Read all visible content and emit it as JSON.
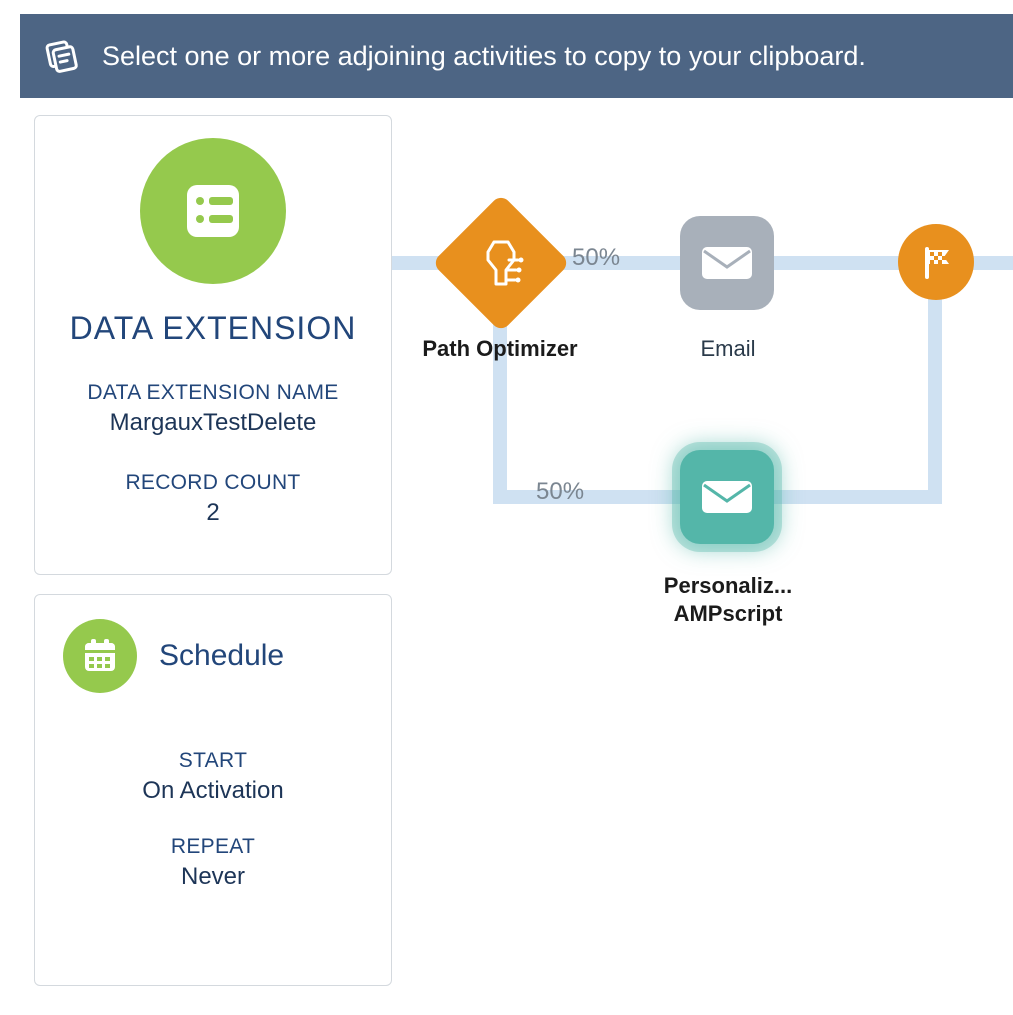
{
  "banner": {
    "text": "Select one or more adjoining activities to copy to your clipboard."
  },
  "entry": {
    "title": "DATA EXTENSION",
    "name_label": "DATA EXTENSION NAME",
    "name_value": "MargauxTestDelete",
    "count_label": "RECORD COUNT",
    "count_value": "2"
  },
  "schedule": {
    "title": "Schedule",
    "start_label": "START",
    "start_value": "On Activation",
    "repeat_label": "REPEAT",
    "repeat_value": "Never"
  },
  "flow": {
    "path_optimizer": {
      "label": "Path Optimizer",
      "top_pct": "50%",
      "bottom_pct": "50%"
    },
    "email_top": {
      "label": "Email"
    },
    "email_bottom": {
      "label_line1": "Personaliz...",
      "label_line2": "AMPscript"
    },
    "goal": {
      "label": ""
    }
  }
}
